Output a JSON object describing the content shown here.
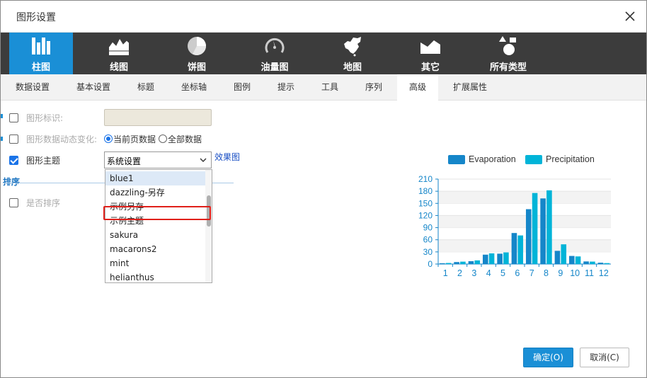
{
  "dialog": {
    "title": "图形设置",
    "ok_label": "确定(O)",
    "cancel_label": "取消(C)"
  },
  "chart_types": [
    {
      "label": "柱图",
      "icon": "bar-chart-icon",
      "active": true
    },
    {
      "label": "线图",
      "icon": "line-chart-icon",
      "active": false
    },
    {
      "label": "饼图",
      "icon": "pie-chart-icon",
      "active": false
    },
    {
      "label": "油量图",
      "icon": "gauge-icon",
      "active": false
    },
    {
      "label": "地图",
      "icon": "china-map-icon",
      "active": false
    },
    {
      "label": "其它",
      "icon": "other-chart-icon",
      "active": false
    },
    {
      "label": "所有类型",
      "icon": "shapes-icon",
      "active": false
    }
  ],
  "tabs": [
    "数据设置",
    "基本设置",
    "标题",
    "坐标轴",
    "图例",
    "提示",
    "工具",
    "序列",
    "高级",
    "扩展属性"
  ],
  "active_tab": "高级",
  "form": {
    "graph_id_label": "图形标识:",
    "dynamic_label": "图形数据动态变化:",
    "radio_current": "当前页数据",
    "radio_all": "全部数据",
    "theme_label": "图形主题",
    "theme_value": "系统设置",
    "effect_link": "效果图",
    "sort_section": "排序",
    "sort_label": "是否排序"
  },
  "theme_options": [
    "blue1",
    "dazzling-另存",
    "示例另存",
    "示例主题",
    "sakura",
    "macarons2",
    "mint",
    "helianthus"
  ],
  "colors": {
    "accent": "#1a8fd6",
    "evaporation": "#1586c9",
    "precipitation": "#00b4d8"
  },
  "chart_data": {
    "type": "bar",
    "categories": [
      "1",
      "2",
      "3",
      "4",
      "5",
      "6",
      "7",
      "8",
      "9",
      "10",
      "11",
      "12"
    ],
    "series": [
      {
        "name": "Evaporation",
        "values": [
          2.0,
          4.9,
          7.0,
          23.2,
          25.6,
          76.7,
          135.6,
          162.2,
          32.6,
          20.0,
          6.4,
          3.3
        ]
      },
      {
        "name": "Precipitation",
        "values": [
          2.6,
          5.9,
          9.0,
          26.4,
          28.7,
          70.7,
          175.6,
          182.2,
          48.7,
          18.8,
          6.0,
          2.3
        ]
      }
    ],
    "ylim": [
      0,
      210
    ],
    "yticks": [
      "0",
      "30",
      "60",
      "90",
      "120",
      "150",
      "180",
      "210"
    ],
    "legend_position": "top"
  }
}
